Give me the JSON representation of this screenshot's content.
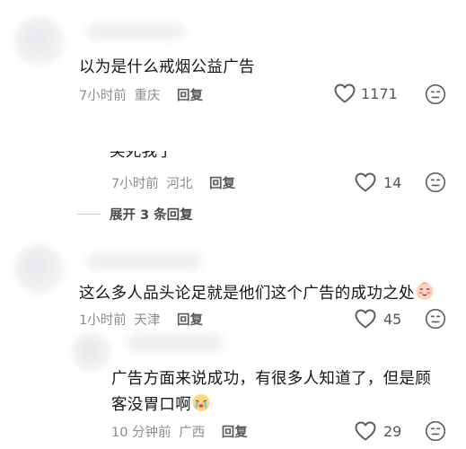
{
  "comments": [
    {
      "text": "以为是什么戒烟公益广告",
      "time": "7小时前",
      "location": "重庆",
      "reply_label": "回复",
      "likes": "1171"
    },
    {
      "text": "笑死我了",
      "time": "7小时前",
      "location": "河北",
      "reply_label": "回复",
      "likes": "14"
    },
    {
      "text": "这么多人品头论足就是他们这个广告的成功之处",
      "time": "1小时前",
      "location": "天津",
      "reply_label": "回复",
      "likes": "45",
      "emoji": "blush-emoji"
    },
    {
      "text_line1": "广告方面来说成功，有很多人知道了，但是顾",
      "text_line2": "客没胃口啊",
      "time": "10 分钟前",
      "location": "广西",
      "reply_label": "回复",
      "likes": "29",
      "emoji": "crying-emoji"
    }
  ],
  "expand_replies": "展开 3 条回复",
  "icons": {
    "like": "heart-icon",
    "dislike": "neutral-face-icon"
  },
  "colors": {
    "text": "#161616",
    "meta": "#8c8c8c",
    "icon": "#5c5c5c"
  }
}
